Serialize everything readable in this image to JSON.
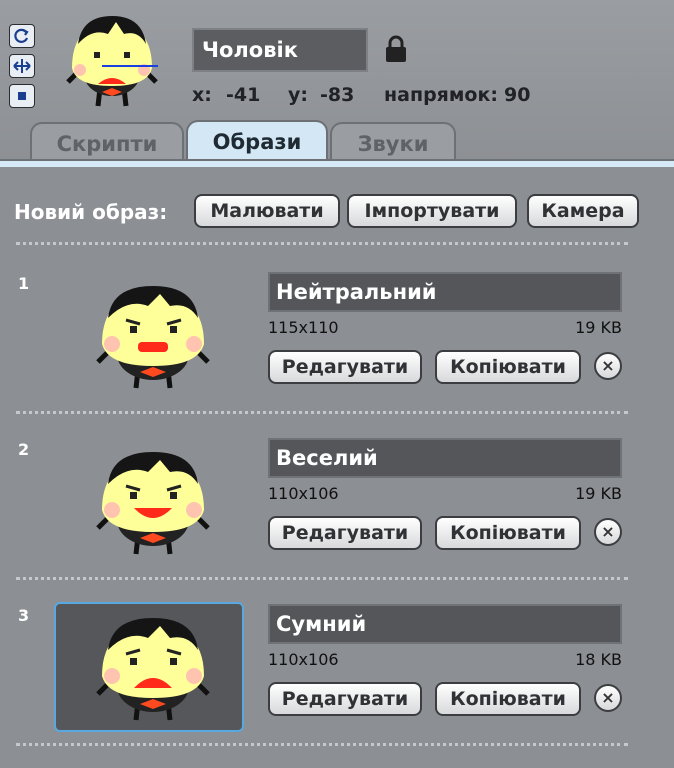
{
  "header": {
    "sprite_name": "Чоловік",
    "x_label": "x:",
    "x_value": "-41",
    "y_label": "y:",
    "y_value": "-83",
    "direction_label": "напрямок:",
    "direction_value": "90"
  },
  "rotation_buttons": [
    "rotate-icon",
    "flip-horizontal-icon",
    "no-rotate-icon"
  ],
  "tabs": [
    {
      "label": "Скрипти",
      "active": false
    },
    {
      "label": "Образи",
      "active": true
    },
    {
      "label": "Звуки",
      "active": false
    }
  ],
  "new_costume": {
    "label": "Новий образ:",
    "paint": "Малювати",
    "import": "Імпортувати",
    "camera": "Камера"
  },
  "costumes": [
    {
      "index": "1",
      "name": "Нейтральний",
      "dims": "115x110",
      "size": "19 KB",
      "edit": "Редагувати",
      "copy": "Копіювати",
      "delete": "×",
      "mouth": "neutral"
    },
    {
      "index": "2",
      "name": "Веселий",
      "dims": "110x106",
      "size": "19 KB",
      "edit": "Редагувати",
      "copy": "Копіювати",
      "delete": "×",
      "mouth": "happy"
    },
    {
      "index": "3",
      "name": "Сумний",
      "dims": "110x106",
      "size": "18 KB",
      "edit": "Редагувати",
      "copy": "Копіювати",
      "delete": "×",
      "mouth": "sad",
      "selected": true
    }
  ],
  "colors": {
    "accent": "#59a8e0",
    "face": "#ffff99",
    "tab_active": "#d3e7f4"
  }
}
